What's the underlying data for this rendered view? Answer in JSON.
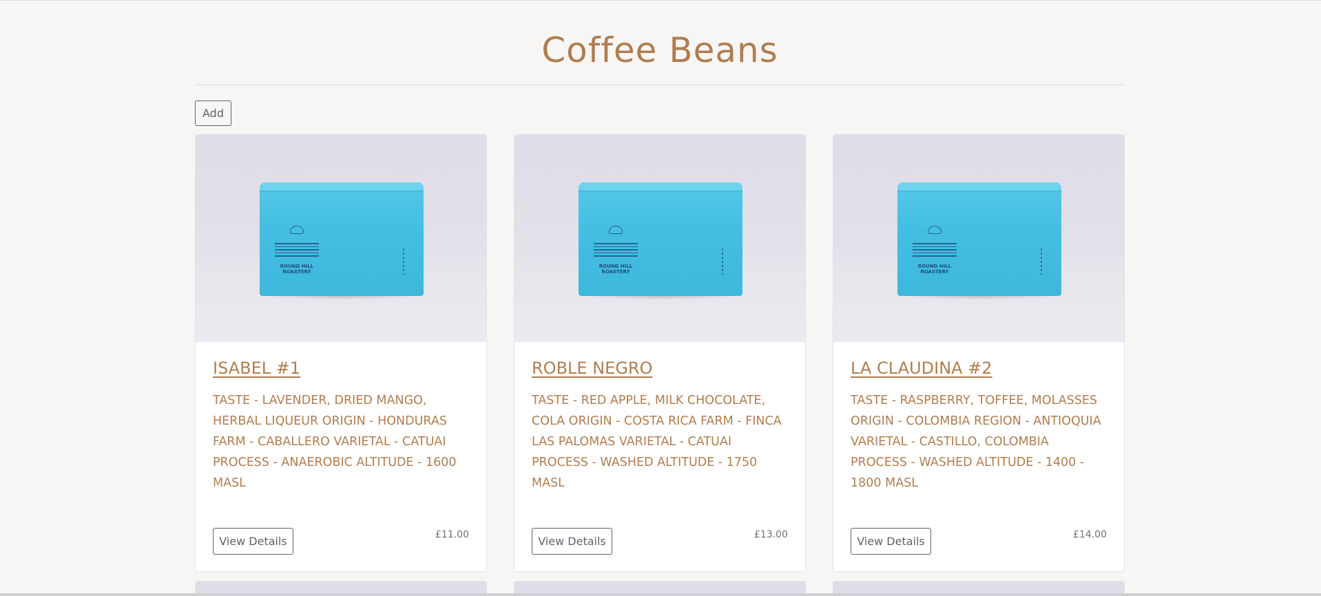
{
  "page": {
    "title": "Coffee Beans",
    "add_label": "Add"
  },
  "products": [
    {
      "name": "ISABEL #1",
      "description": "TASTE - LAVENDER, DRIED MANGO, HERBAL LIQUEUR ORIGIN - HONDURAS FARM - CABALLERO VARIETAL - CATUAI PROCESS - ANAEROBIC ALTITUDE - 1600 MASL",
      "price": "£11.00",
      "button_label": "View Details",
      "image_brand": "ROUND HILL ROASTERY"
    },
    {
      "name": "ROBLE NEGRO",
      "description": "TASTE - RED APPLE, MILK CHOCOLATE, COLA ORIGIN - COSTA RICA FARM - FINCA LAS PALOMAS VARIETAL - CATUAI PROCESS - WASHED ALTITUDE - 1750 MASL",
      "price": "£13.00",
      "button_label": "View Details",
      "image_brand": "ROUND HILL ROASTERY"
    },
    {
      "name": "LA CLAUDINA #2",
      "description": "TASTE - RASPBERRY, TOFFEE, MOLASSES ORIGIN - COLOMBIA REGION - ANTIOQUIA VARIETAL - CASTILLO, COLOMBIA PROCESS - WASHED ALTITUDE - 1400 - 1800 MASL",
      "price": "£14.00",
      "button_label": "View Details",
      "image_brand": "ROUND HILL ROASTERY"
    }
  ],
  "colors": {
    "accent": "#b07d4f",
    "background": "#f7f6f4",
    "bag": "#44bfe2",
    "button_border": "#5d6168"
  }
}
